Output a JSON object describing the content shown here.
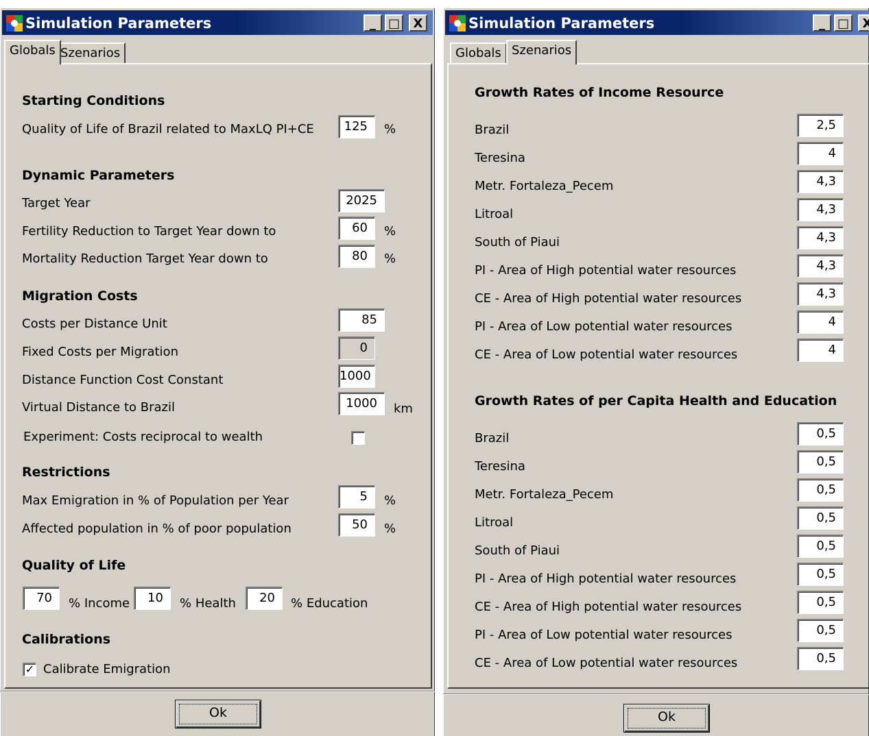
{
  "left": {
    "title": "Simulation Parameters",
    "window_buttons": {
      "minimize": "_",
      "maximize": "□",
      "close": "X"
    },
    "tabs": [
      {
        "label": "Globals",
        "active": true
      },
      {
        "label": "Szenarios",
        "active": false
      }
    ],
    "sections": {
      "starting": "Starting Conditions",
      "dynamic": "Dynamic Parameters",
      "migration": "Migration Costs",
      "restrictions": "Restrictions",
      "qol": "Quality of Life",
      "calibrations": "Calibrations"
    },
    "quality_of_life_brazil": {
      "label": "Quality of Life of Brazil related to MaxLQ PI+CE",
      "value": "125",
      "unit": "%"
    },
    "target_year": {
      "label": "Target Year",
      "value": "2025"
    },
    "fertility": {
      "label": "Fertility Reduction to Target Year down to",
      "value": "60",
      "unit": "%"
    },
    "mortality": {
      "label": "Mortality Reduction Target Year down to",
      "value": "80",
      "unit": "%"
    },
    "costs_per_distance": {
      "label": "Costs per Distance Unit",
      "value": "85"
    },
    "fixed_costs": {
      "label": "Fixed Costs per Migration",
      "value": "0"
    },
    "distance_constant": {
      "label": "Distance Function Cost Constant",
      "value": "1000"
    },
    "virtual_distance": {
      "label": "Virtual Distance to Brazil",
      "value": "1000",
      "unit": "km"
    },
    "experiment": {
      "label": "Experiment: Costs reciprocal to wealth",
      "checked": false
    },
    "max_emigration": {
      "label": "Max Emigration in % of Population per Year",
      "value": "5",
      "unit": "%"
    },
    "affected_population": {
      "label": "Affected population in % of poor population",
      "value": "50",
      "unit": "%"
    },
    "qol_weights": {
      "income": {
        "value": "70",
        "label": "% Income"
      },
      "health": {
        "value": "10",
        "label": "% Health"
      },
      "education": {
        "value": "20",
        "label": "% Education"
      }
    },
    "calibrate": {
      "label": "Calibrate Emigration",
      "checked": true,
      "mark": "✓"
    },
    "ok_label": "Ok"
  },
  "right": {
    "title": "Simulation Parameters",
    "window_buttons": {
      "minimize": "_",
      "maximize": "□",
      "close": "X"
    },
    "tabs": [
      {
        "label": "Globals",
        "active": false
      },
      {
        "label": "Szenarios",
        "active": true
      }
    ],
    "income_section": "Growth Rates of Income Resource",
    "income_rows": [
      {
        "label": "Brazil",
        "value": "2,5"
      },
      {
        "label": "Teresina",
        "value": "4"
      },
      {
        "label": "Metr. Fortaleza_Pecem",
        "value": "4,3"
      },
      {
        "label": "Litroal",
        "value": "4,3"
      },
      {
        "label": "South of Piaui",
        "value": "4,3"
      },
      {
        "label": "PI - Area of High potential water resources",
        "value": "4,3"
      },
      {
        "label": "CE - Area of High potential water resources",
        "value": "4,3"
      },
      {
        "label": "PI - Area of Low potential water resources",
        "value": "4"
      },
      {
        "label": "CE - Area of Low potential water resources",
        "value": "4"
      }
    ],
    "health_section": "Growth Rates of per Capita Health and Education",
    "health_rows": [
      {
        "label": "Brazil",
        "value": "0,5"
      },
      {
        "label": "Teresina",
        "value": "0,5"
      },
      {
        "label": "Metr. Fortaleza_Pecem",
        "value": "0,5"
      },
      {
        "label": "Litroal",
        "value": "0,5"
      },
      {
        "label": "South of Piaui",
        "value": "0,5"
      },
      {
        "label": "PI - Area of High potential water resources",
        "value": "0,5"
      },
      {
        "label": "CE - Area of High potential water resources",
        "value": "0,5"
      },
      {
        "label": "PI - Area of Low potential water resources",
        "value": "0,5"
      },
      {
        "label": "CE - Area of Low potential water resources",
        "value": "0,5"
      }
    ],
    "ok_label": "Ok"
  }
}
